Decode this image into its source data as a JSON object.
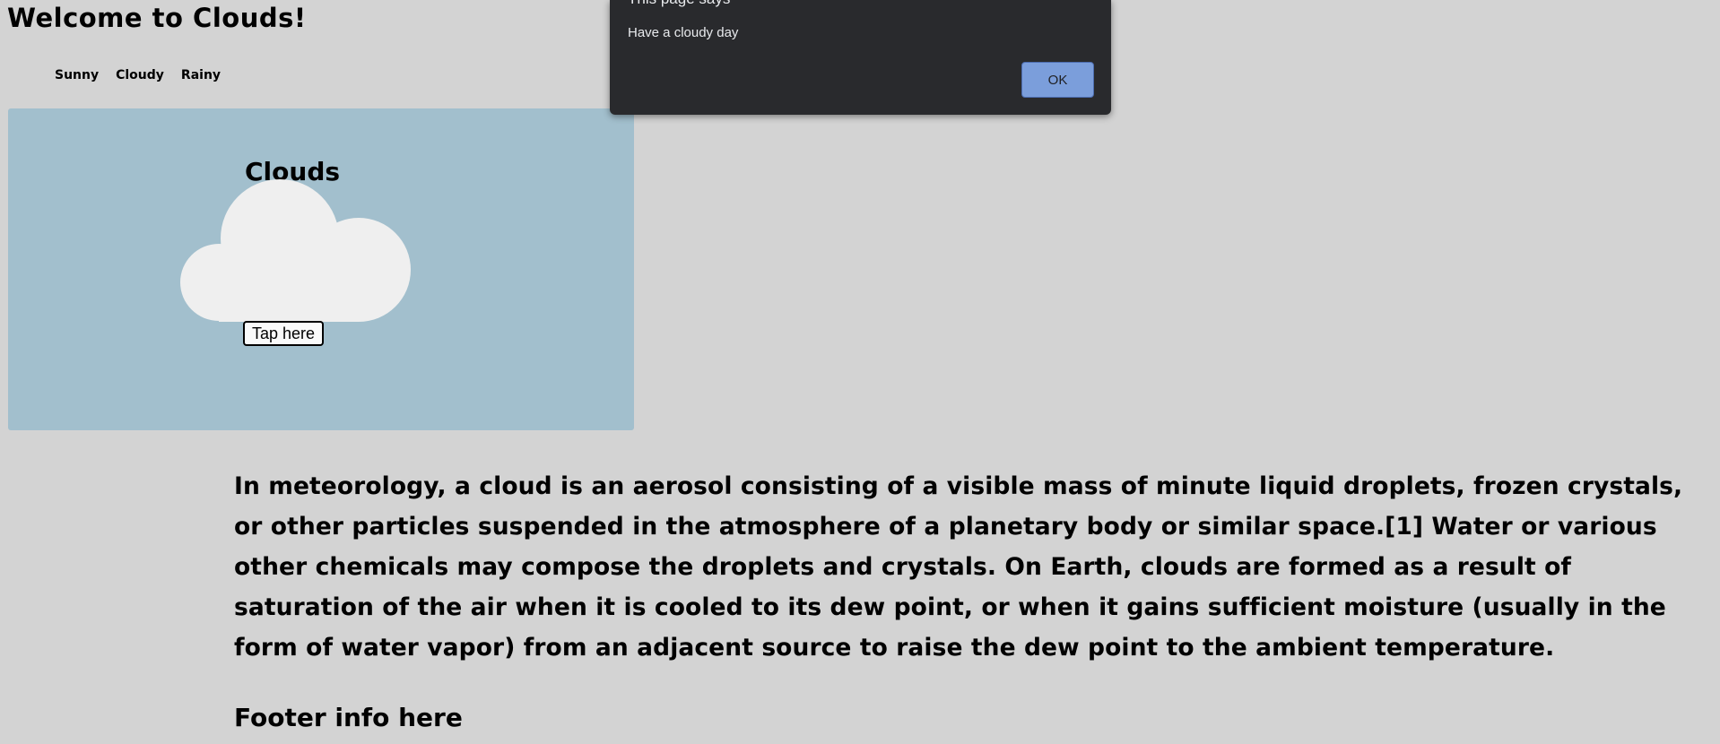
{
  "header": {
    "title": "Welcome to Clouds!"
  },
  "nav": {
    "items": [
      {
        "label": "Sunny"
      },
      {
        "label": "Cloudy"
      },
      {
        "label": "Rainy"
      }
    ]
  },
  "hero": {
    "heading": "Clouds",
    "button_label": "Tap here",
    "icon": "cloud-icon",
    "background_color": "#a2bfcd",
    "cloud_color": "#efefef"
  },
  "article": {
    "text": "In meteorology, a cloud is an aerosol consisting of a visible mass of minute liquid droplets, frozen crystals, or other particles suspended in the atmosphere of a planetary body or similar space.[1] Water or various other chemicals may compose the droplets and crystals. On Earth, clouds are formed as a result of saturation of the air when it is cooled to its dew point, or when it gains sufficient moisture (usually in the form of water vapor) from an adjacent source to raise the dew point to the ambient temperature."
  },
  "footer": {
    "text": "Footer info here"
  },
  "dialog": {
    "title": "This page says",
    "message": "Have a cloudy day",
    "ok_label": "OK",
    "accent_color": "#7b9edb",
    "background_color": "#292a2d"
  },
  "page": {
    "background_color": "#d3d3d3"
  }
}
